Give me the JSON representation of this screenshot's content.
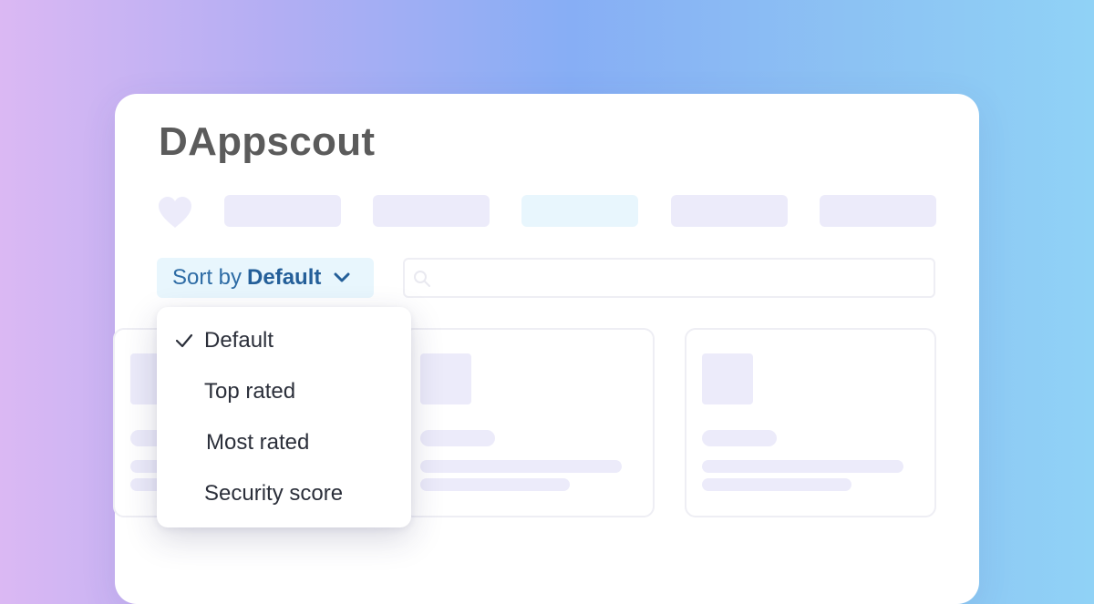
{
  "app": {
    "title": "DAppscout"
  },
  "icons": {
    "favorite": "heart-icon",
    "search": "search-icon",
    "sort_toggle": "chevron-down-icon",
    "selected": "checkmark-icon"
  },
  "sort": {
    "label": "Sort by",
    "value": "Default",
    "options": [
      "Default",
      "Top rated",
      "Most rated",
      "Security score"
    ],
    "selected_index": 0
  },
  "search": {
    "placeholder": ""
  },
  "colors": {
    "accent": "#245f99",
    "sort_bg": "#e8f6fd",
    "placeholder": "#ecebfa",
    "heart": "#ecebfa"
  }
}
